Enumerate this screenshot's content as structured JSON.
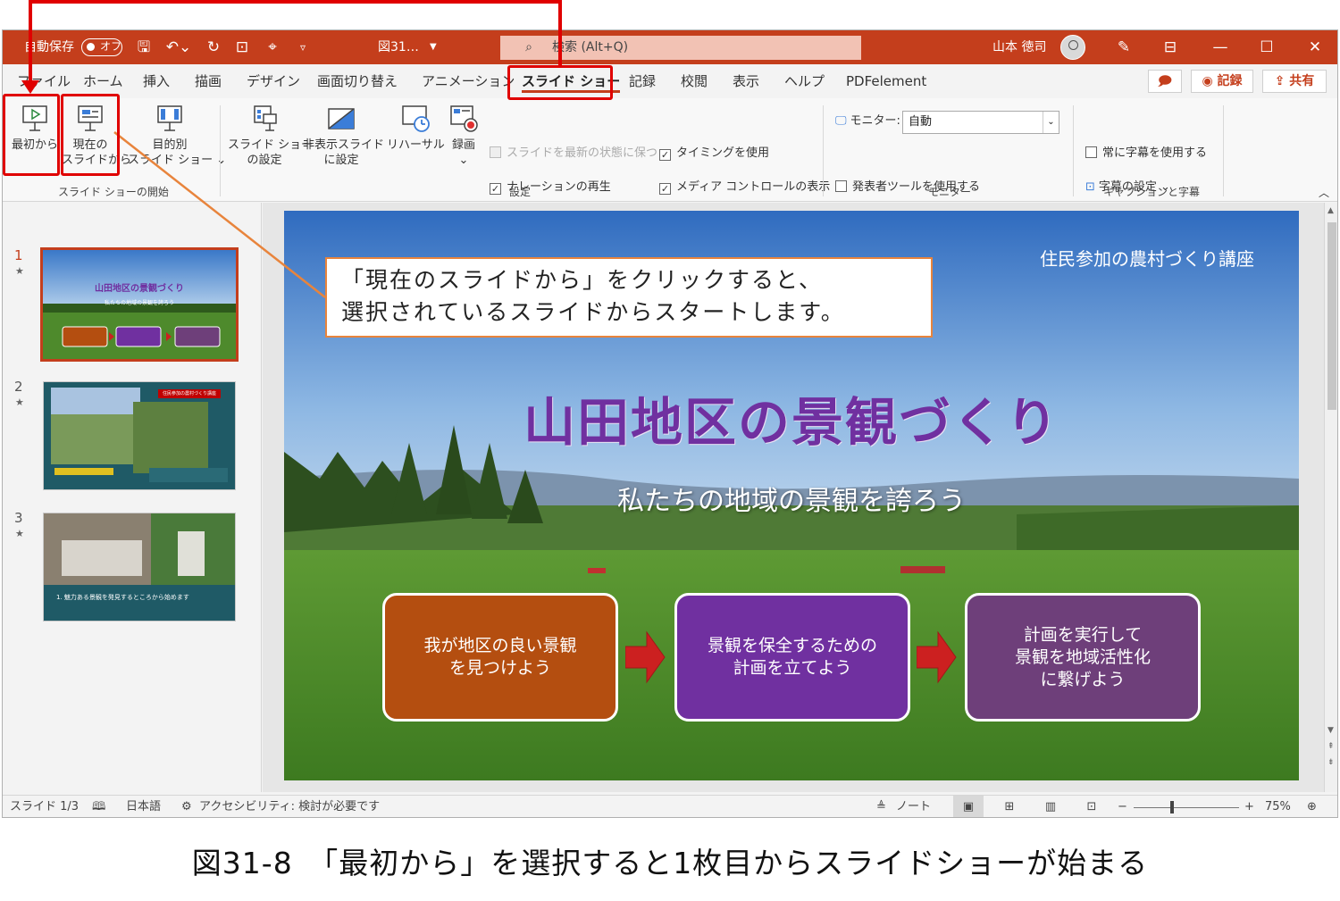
{
  "titlebar": {
    "autosave": "自動保存",
    "autosave_state": "オフ",
    "filename": "図31…",
    "search_placeholder": "検索 (Alt+Q)",
    "user": "山本 徳司"
  },
  "tabs": [
    "ファイル",
    "ホーム",
    "挿入",
    "描画",
    "デザイン",
    "画面切り替え",
    "アニメーション",
    "スライド ショー",
    "記録",
    "校閲",
    "表示",
    "ヘルプ",
    "PDFelement"
  ],
  "tab_buttons": {
    "record": "記録",
    "share": "共有"
  },
  "ribbon": {
    "from_beginning": "最初から",
    "from_current_1": "現在の",
    "from_current_2": "スライドから",
    "custom_1": "目的別",
    "custom_2": "スライド ショー ⌄",
    "setup_1": "スライド ショー",
    "setup_2": "の設定",
    "hide_1": "非表示スライド",
    "hide_2": "に設定",
    "rehearse": "リハーサル",
    "record": "録画",
    "record_arrow": "⌄",
    "keep_updated": "スライドを最新の状態に保つ",
    "use_timings": "タイミングを使用",
    "play_narrations": "ナレーションの再生",
    "show_media_controls": "メディア コントロールの表示",
    "monitor_label": "モニター:",
    "monitor_value": "自動",
    "presenter_view": "発表者ツールを使用する",
    "always_subtitles": "常に字幕を使用する",
    "subtitle_settings": "字幕の設定 ⌄",
    "group_start": "スライド ショーの開始",
    "group_setup": "設定",
    "group_monitor": "モニター",
    "group_captions": "キャプションと字幕"
  },
  "thumbnails": [
    {
      "num": "1",
      "star": "★",
      "title": "山田地区の景観づくり",
      "sub": "私たちの地域の景観を誇ろう"
    },
    {
      "num": "2",
      "star": "★",
      "label": "住民参加の農村づくり講座"
    },
    {
      "num": "3",
      "star": "★",
      "caption": "1. 魅力ある景観を発見するところから始めます"
    }
  ],
  "slide": {
    "top_text": "住民参加の農村づくり講座",
    "title": "山田地区の景観づくり",
    "subtitle": "私たちの地域の景観を誇ろう",
    "box1": "我が地区の良い景観\nを見つけよう",
    "box2": "景観を保全するための\n計画を立てよう",
    "box3": "計画を実行して\n景観を地域活性化\nに繋げよう"
  },
  "callout": "「現在のスライドから」をクリックすると、\n選択されているスライドからスタートします。",
  "statusbar": {
    "slide": "スライド 1/3",
    "language": "日本語",
    "accessibility": "アクセシビリティ: 検討が必要です",
    "notes": "ノート",
    "zoom_minus": "−",
    "zoom_plus": "+",
    "zoom": "75%"
  },
  "caption": "図31-8　「最初から」を選択すると1枚目からスライドショーが始まる",
  "colors": {
    "accent": "#c43e1c",
    "title_purple": "#7030a0",
    "box1": "#b44e10",
    "box2": "#7030a0",
    "box3": "#6e3f7a",
    "highlight_red": "#e00000",
    "callout_border": "#e8843c"
  }
}
